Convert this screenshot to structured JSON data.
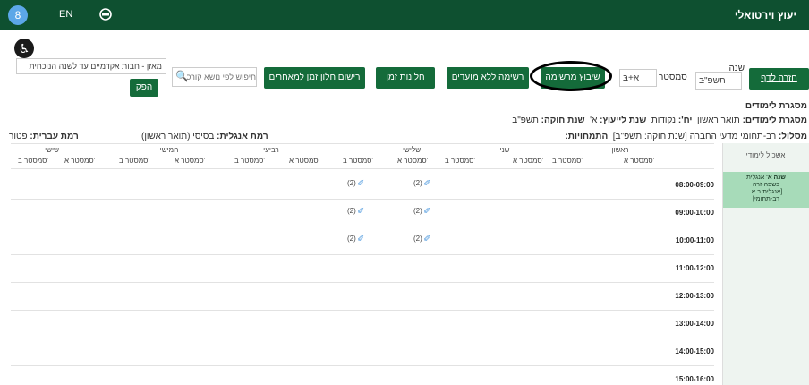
{
  "header": {
    "app_title": "יעוץ וירטואלי",
    "avatar": "8",
    "lang": "EN"
  },
  "toolbar": {
    "back_link": "חזרה לדף",
    "year_label": "שנה",
    "year_value": "תשפ\"ב",
    "semester_label": "סמסטר",
    "semester_value": "א+ב",
    "btn_registration": "שיבוץ מרשימה",
    "btn_list_no_dates": "רשימה ללא מועדים",
    "btn_time_windows": "חלונות זמן",
    "btn_register_window": "רישום חלון זמן למאחרים",
    "search_placeholder": "חיפוש לפי נושא קורס",
    "balance_select": "מאזן - חבות אקדמיים עד לשנה הנוכחית",
    "btn_produce": "הפק"
  },
  "info": {
    "framework_title": "מסגרת לימודים",
    "framework_label": "מסגרת לימודים:",
    "framework_value": "תואר ראשון",
    "points_label": "יח':",
    "points_value": "נקודות",
    "advice_year_label": "שנת לייעוץ:",
    "advice_year_value": "א'",
    "law_year_label": "שנת חוקה:",
    "law_year_value": "תשפ\"ב",
    "track_label": "מסלול:",
    "track_value": "רב-תחומי מדעי החברה [שנת חוקה: תשפ\"ב]",
    "specializations_label": "התמחויות:",
    "english_label": "רמת אנגלית:",
    "english_value": "בסיסי (תואר ראשון)",
    "hebrew_label": "רמת עברית:",
    "hebrew_value": "פטור"
  },
  "days": [
    {
      "name": "ראשון",
      "sem_a": "סמסטר א'",
      "sem_b": "סמסטר ב'"
    },
    {
      "name": "שני",
      "sem_a": "סמסטר א'",
      "sem_b": "סמסטר ב'"
    },
    {
      "name": "שלישי",
      "sem_a": "סמסטר א'",
      "sem_b": "סמסטר ב'"
    },
    {
      "name": "רביעי",
      "sem_a": "סמסטר א'",
      "sem_b": "סמסטר ב'"
    },
    {
      "name": "חמישי",
      "sem_a": "סמסטר א'",
      "sem_b": "סמסטר ב'"
    },
    {
      "name": "שישי",
      "sem_a": "סמסטר א'",
      "sem_b": "סמסטר ב'"
    }
  ],
  "times": [
    "08:00-09:00",
    "09:00-10:00",
    "10:00-11:00",
    "11:00-12:00",
    "12:00-13:00",
    "13:00-14:00",
    "14:00-15:00",
    "15:00-16:00"
  ],
  "slot_count": "(2)",
  "panel": {
    "title": "אשכול לימודי",
    "card_line1_bold": "שנה א'",
    "card_line1": "אנגלית",
    "card_line2": "כשפה-זרה",
    "card_line3": "[אנגלית ב.א.",
    "card_line4": "רב-תחומי]"
  },
  "colors": {
    "header": "#0e5030",
    "button": "#146b3a",
    "card": "#a7dbb9"
  }
}
